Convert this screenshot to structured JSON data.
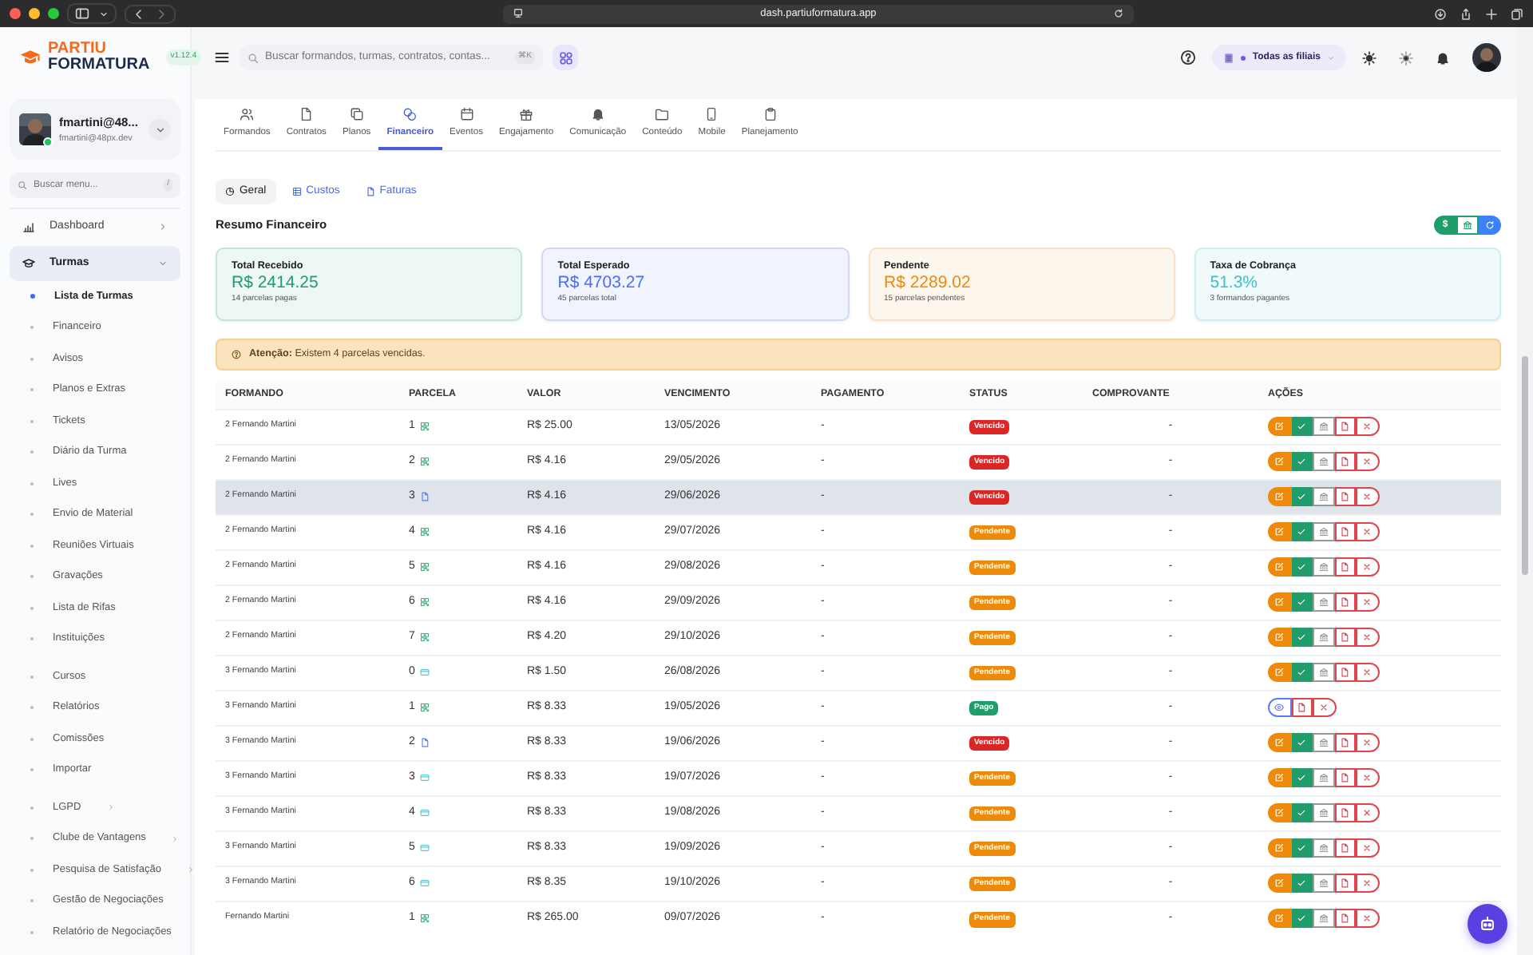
{
  "browser": {
    "url": "dash.partiuformatura.app"
  },
  "sidebar": {
    "logo": {
      "line1": "PARTIU",
      "line2": "FORMATURA"
    },
    "version": "v1.12.4",
    "user": {
      "name": "fmartini@48...",
      "email": "fmartini@48px.dev",
      "online": true
    },
    "search": {
      "placeholder": "Buscar menu...",
      "shortcut": "/"
    },
    "nav": [
      {
        "label": "Dashboard",
        "selected": false,
        "expanded": false
      },
      {
        "label": "Turmas",
        "selected": true,
        "expanded": true,
        "sections": [
          {
            "items": [
              {
                "label": "Lista de Turmas",
                "selected": true,
                "has_submenu": false
              },
              {
                "label": "Financeiro",
                "selected": false,
                "has_submenu": false
              },
              {
                "label": "Avisos",
                "selected": false,
                "has_submenu": false
              },
              {
                "label": "Planos e Extras",
                "selected": false,
                "has_submenu": false
              },
              {
                "label": "Tickets",
                "selected": false,
                "has_submenu": false
              },
              {
                "label": "Diário da Turma",
                "selected": false,
                "has_submenu": false
              },
              {
                "label": "Lives",
                "selected": false,
                "has_submenu": false
              },
              {
                "label": "Envio de Material",
                "selected": false,
                "has_submenu": false
              },
              {
                "label": "Reuniões Virtuais",
                "selected": false,
                "has_submenu": false
              },
              {
                "label": "Gravações",
                "selected": false,
                "has_submenu": false
              },
              {
                "label": "Lista de Rifas",
                "selected": false,
                "has_submenu": false
              },
              {
                "label": "Instituições",
                "selected": false,
                "has_submenu": false
              }
            ]
          },
          {
            "items": [
              {
                "label": "Cursos",
                "selected": false,
                "has_submenu": false
              },
              {
                "label": "Relatórios",
                "selected": false,
                "has_submenu": false
              },
              {
                "label": "Comissões",
                "selected": false,
                "has_submenu": false
              },
              {
                "label": "Importar",
                "selected": false,
                "has_submenu": false
              }
            ]
          },
          {
            "items": [
              {
                "label": "LGPD",
                "selected": false,
                "has_submenu": true
              },
              {
                "label": "Clube de Vantagens",
                "selected": false,
                "has_submenu": true
              },
              {
                "label": "Pesquisa de Satisfação",
                "selected": false,
                "has_submenu": true
              },
              {
                "label": "Gestão de Negociações",
                "selected": false,
                "has_submenu": false
              },
              {
                "label": "Relatório de Negociações",
                "selected": false,
                "has_submenu": false
              }
            ]
          }
        ]
      }
    ]
  },
  "header": {
    "search": {
      "placeholder": "Buscar formandos, turmas, contratos, contas...",
      "shortcut": "⌘K"
    },
    "branch_filter": "Todas as filiais"
  },
  "tabs": [
    {
      "label": "Formandos",
      "selected": false
    },
    {
      "label": "Contratos",
      "selected": false
    },
    {
      "label": "Planos",
      "selected": false
    },
    {
      "label": "Financeiro",
      "selected": true
    },
    {
      "label": "Eventos",
      "selected": false
    },
    {
      "label": "Engajamento",
      "selected": false
    },
    {
      "label": "Comunicação",
      "selected": false
    },
    {
      "label": "Conteúdo",
      "selected": false
    },
    {
      "label": "Mobile",
      "selected": false
    },
    {
      "label": "Planejamento",
      "selected": false
    }
  ],
  "subtabs": [
    {
      "label": "Geral",
      "selected": true
    },
    {
      "label": "Custos",
      "selected": false
    },
    {
      "label": "Faturas",
      "selected": false
    }
  ],
  "summary": {
    "title": "Resumo Financeiro",
    "action_label": "$",
    "cards": [
      {
        "title": "Total Recebido",
        "value": "R$ 2414.25",
        "caption": "14 parcelas pagas",
        "color": "#1f9d6b"
      },
      {
        "title": "Total Esperado",
        "value": "R$ 4703.27",
        "caption": "45 parcelas total",
        "color": "#4a6cf7"
      },
      {
        "title": "Pendente",
        "value": "R$ 2289.02",
        "caption": "15 parcelas pendentes",
        "color": "#e98a15"
      },
      {
        "title": "Taxa de Cobrança",
        "value": "51.3%",
        "caption": "3 formandos pagantes",
        "color": "#3cc0cf"
      }
    ]
  },
  "alert": "**Atenção:** Existem 4 parcelas vencidas.",
  "table": {
    "columns": [
      "FORMANDO",
      "PARCELA",
      "VALOR",
      "VENCIMENTO",
      "PAGAMENTO",
      "STATUS",
      "COMPROVANTE",
      "AÇÕES"
    ],
    "rows": [
      {
        "formando": "2 Fernando Martini",
        "parcela": {
          "label": "1",
          "kind": "qr"
        },
        "valor": "R$ 25.00",
        "vencimento": "13/05/2026",
        "pagamento": "-",
        "status": {
          "label": "Vencido",
          "color": "#dc2626"
        },
        "comprovante": "-",
        "kind": "full",
        "selected": false
      },
      {
        "formando": "2 Fernando Martini",
        "parcela": {
          "label": "2",
          "kind": "qr"
        },
        "valor": "R$ 4.16",
        "vencimento": "29/05/2026",
        "pagamento": "-",
        "status": {
          "label": "Vencido",
          "color": "#dc2626"
        },
        "comprovante": "-",
        "kind": "full",
        "selected": false
      },
      {
        "formando": "2 Fernando Martini",
        "parcela": {
          "label": "3",
          "kind": "doc"
        },
        "valor": "R$ 4.16",
        "vencimento": "29/06/2026",
        "pagamento": "-",
        "status": {
          "label": "Vencido",
          "color": "#dc2626"
        },
        "comprovante": "-",
        "kind": "full",
        "selected": true
      },
      {
        "formando": "2 Fernando Martini",
        "parcela": {
          "label": "4",
          "kind": "qr"
        },
        "valor": "R$ 4.16",
        "vencimento": "29/07/2026",
        "pagamento": "-",
        "status": {
          "label": "Pendente",
          "color": "#ee8a0b"
        },
        "comprovante": "-",
        "kind": "full",
        "selected": false
      },
      {
        "formando": "2 Fernando Martini",
        "parcela": {
          "label": "5",
          "kind": "qr"
        },
        "valor": "R$ 4.16",
        "vencimento": "29/08/2026",
        "pagamento": "-",
        "status": {
          "label": "Pendente",
          "color": "#ee8a0b"
        },
        "comprovante": "-",
        "kind": "full",
        "selected": false
      },
      {
        "formando": "2 Fernando Martini",
        "parcela": {
          "label": "6",
          "kind": "qr"
        },
        "valor": "R$ 4.16",
        "vencimento": "29/09/2026",
        "pagamento": "-",
        "status": {
          "label": "Pendente",
          "color": "#ee8a0b"
        },
        "comprovante": "-",
        "kind": "full",
        "selected": false
      },
      {
        "formando": "2 Fernando Martini",
        "parcela": {
          "label": "7",
          "kind": "qr"
        },
        "valor": "R$ 4.20",
        "vencimento": "29/10/2026",
        "pagamento": "-",
        "status": {
          "label": "Pendente",
          "color": "#ee8a0b"
        },
        "comprovante": "-",
        "kind": "full",
        "selected": false
      },
      {
        "formando": "3 Fernando Martini",
        "parcela": {
          "label": "0",
          "kind": "card"
        },
        "valor": "R$ 1.50",
        "vencimento": "26/08/2026",
        "pagamento": "-",
        "status": {
          "label": "Pendente",
          "color": "#ee8a0b"
        },
        "comprovante": "-",
        "kind": "full",
        "selected": false
      },
      {
        "formando": "3 Fernando Martini",
        "parcela": {
          "label": "1",
          "kind": "qr"
        },
        "valor": "R$ 8.33",
        "vencimento": "19/05/2026",
        "pagamento": "-",
        "status": {
          "label": "Pago",
          "color": "#1f9d6b"
        },
        "comprovante": "-",
        "kind": "paid",
        "selected": false
      },
      {
        "formando": "3 Fernando Martini",
        "parcela": {
          "label": "2",
          "kind": "doc"
        },
        "valor": "R$ 8.33",
        "vencimento": "19/06/2026",
        "pagamento": "-",
        "status": {
          "label": "Vencido",
          "color": "#dc2626"
        },
        "comprovante": "-",
        "kind": "full",
        "selected": false
      },
      {
        "formando": "3 Fernando Martini",
        "parcela": {
          "label": "3",
          "kind": "card"
        },
        "valor": "R$ 8.33",
        "vencimento": "19/07/2026",
        "pagamento": "-",
        "status": {
          "label": "Pendente",
          "color": "#ee8a0b"
        },
        "comprovante": "-",
        "kind": "full",
        "selected": false
      },
      {
        "formando": "3 Fernando Martini",
        "parcela": {
          "label": "4",
          "kind": "card"
        },
        "valor": "R$ 8.33",
        "vencimento": "19/08/2026",
        "pagamento": "-",
        "status": {
          "label": "Pendente",
          "color": "#ee8a0b"
        },
        "comprovante": "-",
        "kind": "full",
        "selected": false
      },
      {
        "formando": "3 Fernando Martini",
        "parcela": {
          "label": "5",
          "kind": "card"
        },
        "valor": "R$ 8.33",
        "vencimento": "19/09/2026",
        "pagamento": "-",
        "status": {
          "label": "Pendente",
          "color": "#ee8a0b"
        },
        "comprovante": "-",
        "kind": "full",
        "selected": false
      },
      {
        "formando": "3 Fernando Martini",
        "parcela": {
          "label": "6",
          "kind": "card"
        },
        "valor": "R$ 8.35",
        "vencimento": "19/10/2026",
        "pagamento": "-",
        "status": {
          "label": "Pendente",
          "color": "#ee8a0b"
        },
        "comprovante": "-",
        "kind": "full",
        "selected": false
      },
      {
        "formando": "Fernando Martini",
        "parcela": {
          "label": "1",
          "kind": "qr"
        },
        "valor": "R$ 265.00",
        "vencimento": "09/07/2026",
        "pagamento": "-",
        "status": {
          "label": "Pendente",
          "color": "#ee8a0b"
        },
        "comprovante": "-",
        "kind": "full",
        "selected": false
      }
    ]
  }
}
